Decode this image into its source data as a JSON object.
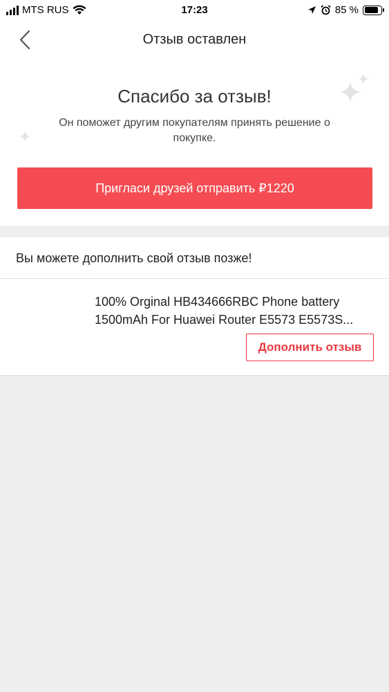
{
  "status_bar": {
    "carrier": "MTS RUS",
    "time": "17:23",
    "battery_percent": "85 %",
    "battery_level": 0.85,
    "icons": [
      "signal-icon",
      "wifi-icon",
      "location-arrow-icon",
      "alarm-icon",
      "battery-icon"
    ]
  },
  "nav": {
    "back_icon": "chevron-left-icon",
    "title": "Отзыв оставлен"
  },
  "hero": {
    "title": "Спасибо за отзыв!",
    "subtitle": "Он поможет другим покупателям принять решение о покупке.",
    "invite_button": "Пригласи друзей отправить ₽1220"
  },
  "later": {
    "heading": "Вы можете дополнить свой отзыв позже!",
    "product": {
      "name_line1": "100% Orginal HB434666RBC Phone battery",
      "name_line2": "1500mAh For Huawei  Router E5573 E5573S...",
      "add_review_button": "Дополнить отзыв"
    }
  },
  "colors": {
    "accent": "#f44c52",
    "accent_text": "#e8383e",
    "background": "#eeeeee"
  }
}
